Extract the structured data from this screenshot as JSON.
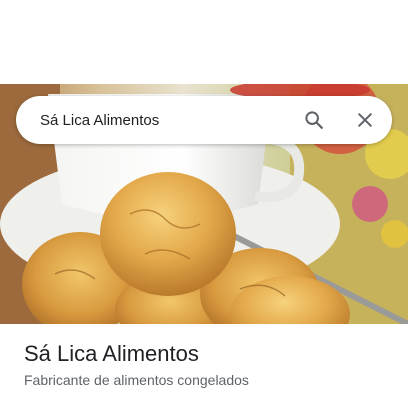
{
  "search": {
    "value": "Sá Lica Alimentos",
    "search_icon": "search-icon",
    "close_icon": "close-icon"
  },
  "hero": {
    "description_icon": "food-photo"
  },
  "place": {
    "title": "Sá Lica Alimentos",
    "subtitle": "Fabricante de alimentos congelados"
  },
  "colors": {
    "title_text": "#202124",
    "subtitle_text": "#5f6368",
    "icon": "#5f6368"
  }
}
